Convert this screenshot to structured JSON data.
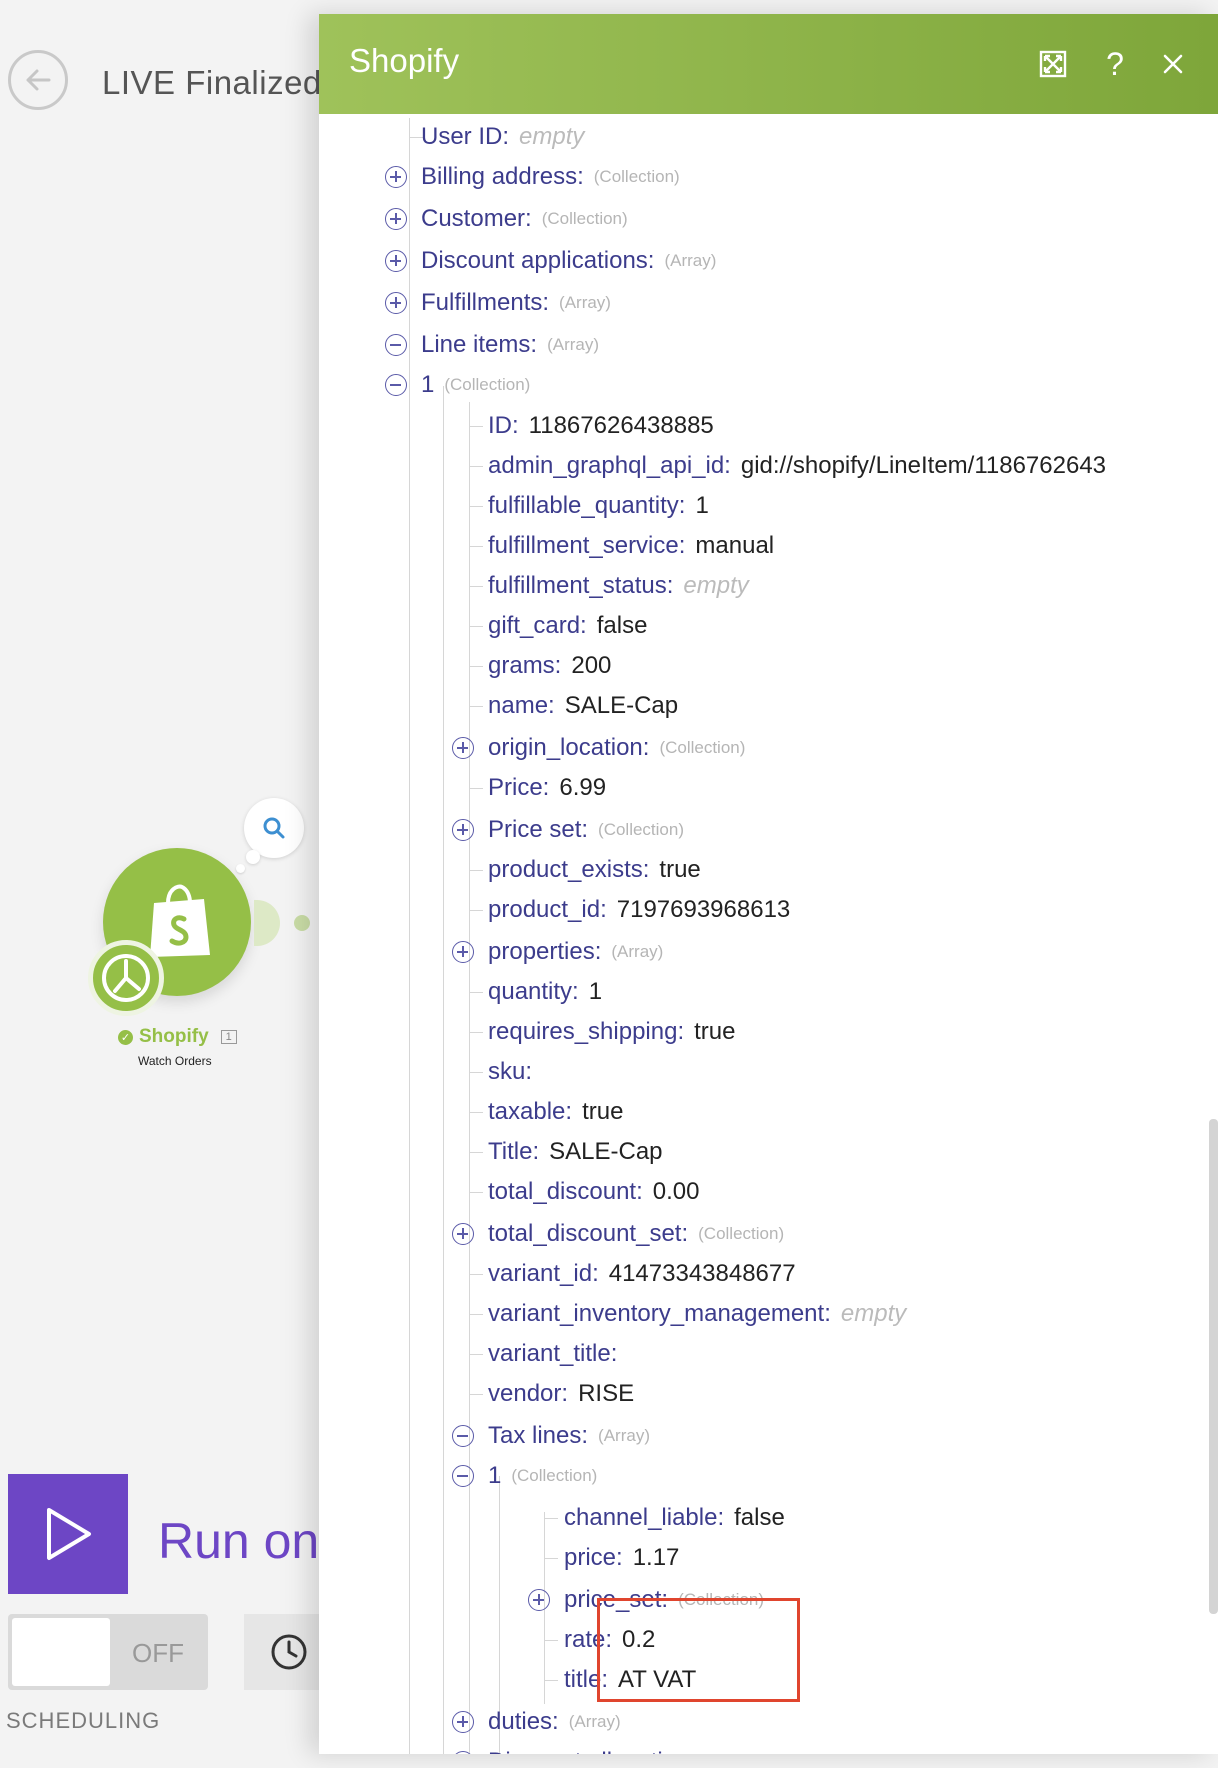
{
  "scenario": {
    "title": "LIVE Finalized"
  },
  "module": {
    "name": "Shopify",
    "subtitle": "Watch Orders",
    "badge": "1",
    "success_color": "#95bf47"
  },
  "controls": {
    "run_label": "Run once",
    "toggle_state": "OFF",
    "scheduling_label": "SCHEDULING",
    "accent": "#6d46c5"
  },
  "panel": {
    "title": "Shopify",
    "header_icons": [
      "expand-icon",
      "help-icon",
      "close-icon"
    ],
    "help_label": "?",
    "rows": [
      {
        "k": "User ID:",
        "e": "empty"
      },
      {
        "k": "Billing address:",
        "t": "(Collection)"
      },
      {
        "k": "Customer:",
        "t": "(Collection)"
      },
      {
        "k": "Discount applications:",
        "t": "(Array)"
      },
      {
        "k": "Fulfillments:",
        "t": "(Array)"
      },
      {
        "k": "Line items:",
        "t": "(Array)"
      },
      {
        "k": "1",
        "t": "(Collection)"
      },
      {
        "k": "ID:",
        "v": "11867626438885"
      },
      {
        "k": "admin_graphql_api_id:",
        "v": "gid://shopify/LineItem/1186762643"
      },
      {
        "k": "fulfillable_quantity:",
        "v": "1"
      },
      {
        "k": "fulfillment_service:",
        "v": "manual"
      },
      {
        "k": "fulfillment_status:",
        "e": "empty"
      },
      {
        "k": "gift_card:",
        "v": "false"
      },
      {
        "k": "grams:",
        "v": "200"
      },
      {
        "k": "name:",
        "v": "SALE-Cap"
      },
      {
        "k": "origin_location:",
        "t": "(Collection)"
      },
      {
        "k": "Price:",
        "v": "6.99"
      },
      {
        "k": "Price set:",
        "t": "(Collection)"
      },
      {
        "k": "product_exists:",
        "v": "true"
      },
      {
        "k": "product_id:",
        "v": "7197693968613"
      },
      {
        "k": "properties:",
        "t": "(Array)"
      },
      {
        "k": "quantity:",
        "v": "1"
      },
      {
        "k": "requires_shipping:",
        "v": "true"
      },
      {
        "k": "sku:"
      },
      {
        "k": "taxable:",
        "v": "true"
      },
      {
        "k": "Title:",
        "v": "SALE-Cap"
      },
      {
        "k": "total_discount:",
        "v": "0.00"
      },
      {
        "k": "total_discount_set:",
        "t": "(Collection)"
      },
      {
        "k": "variant_id:",
        "v": "41473343848677"
      },
      {
        "k": "variant_inventory_management:",
        "e": "empty"
      },
      {
        "k": "variant_title:"
      },
      {
        "k": "vendor:",
        "v": "RISE"
      },
      {
        "k": "Tax lines:",
        "t": "(Array)"
      },
      {
        "k": "1",
        "t": "(Collection)"
      },
      {
        "k": "channel_liable:",
        "v": "false"
      },
      {
        "k": "price:",
        "v": "1.17"
      },
      {
        "k": "price_set:",
        "t": "(Collection)"
      },
      {
        "k": "rate:",
        "v": "0.2"
      },
      {
        "k": "title:",
        "v": "AT VAT"
      },
      {
        "k": "duties:",
        "t": "(Array)"
      },
      {
        "k": "Discount allocations:",
        "t": "(Array)"
      }
    ]
  }
}
